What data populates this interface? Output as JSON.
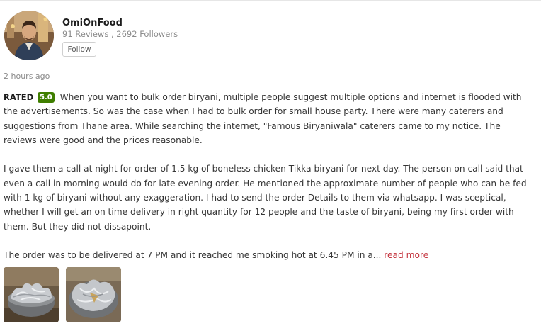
{
  "user": {
    "name": "OmiOnFood",
    "stats": "91 Reviews , 2692 Followers",
    "follow_label": "Follow"
  },
  "timestamp": "2 hours ago",
  "rating": {
    "label": "RATED",
    "value": "5.0",
    "color": "#3f7e00"
  },
  "review": {
    "para1": "When you want to bulk order biryani, multiple people suggest multiple options and internet is flooded with the advertisements. So was the case when I had to bulk order for small house party. There were many caterers and suggestions from Thane area. While searching the internet, \"Famous Biryaniwala\" caterers came to my notice. The reviews were good and the prices reasonable.",
    "para2": "I gave them a call at night for order of 1.5 kg of boneless chicken Tikka biryani for next day. The person on call said that even a call in morning would do for late evening order. He mentioned the approximate number of people who can be fed with 1 kg of biryani without any exaggeration. I had to send the order Details to them via whatsapp. I was sceptical, whether I will get an on time delivery in right quantity for 12 people and the taste of biryani, being my first order with them. But they did not dissapoint.",
    "para3": "The order was to be delivered at 7 PM and it reached me smoking hot at 6.45 PM in a...",
    "read_more": "read more",
    "read_more_color": "#c4343e"
  },
  "photos": [
    "biryani-handi-photo",
    "biryani-handi-photo"
  ]
}
